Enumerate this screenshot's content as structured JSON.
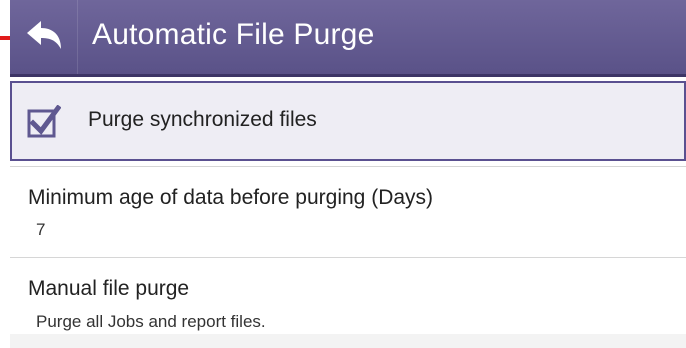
{
  "header": {
    "title": "Automatic File Purge",
    "back_icon": "back-arrow-icon",
    "accent_color": "#5f5890"
  },
  "settings": {
    "purge_synchronized": {
      "label": "Purge synchronized files",
      "checked": true
    },
    "minimum_age": {
      "title": "Minimum age of data before purging (Days)",
      "value": "7"
    },
    "manual_purge": {
      "title": "Manual file purge",
      "summary": "Purge all Jobs and report files."
    }
  }
}
